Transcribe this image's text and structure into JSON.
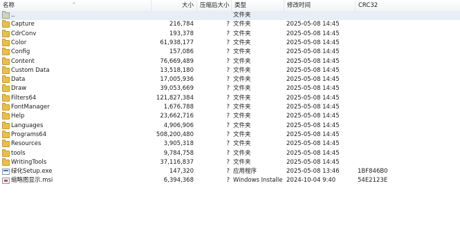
{
  "header": {
    "name": "名称",
    "size": "大小",
    "packed": "压缩后大小",
    "type": "类型",
    "modified": "修改时间",
    "crc": "CRC32"
  },
  "rows": [
    {
      "name": "..",
      "icon": "up-folder-icon",
      "size": "",
      "packed": "",
      "type": "文件夹",
      "modified": "",
      "crc": ""
    },
    {
      "name": "Capture",
      "icon": "folder-icon",
      "size": "216,784",
      "packed": "?",
      "type": "文件夹",
      "modified": "2025-05-08 14:45",
      "crc": ""
    },
    {
      "name": "CdrConv",
      "icon": "folder-icon",
      "size": "193,378",
      "packed": "?",
      "type": "文件夹",
      "modified": "2025-05-08 14:45",
      "crc": ""
    },
    {
      "name": "Color",
      "icon": "folder-icon",
      "size": "61,938,177",
      "packed": "?",
      "type": "文件夹",
      "modified": "2025-05-08 14:45",
      "crc": ""
    },
    {
      "name": "Config",
      "icon": "folder-icon",
      "size": "157,086",
      "packed": "?",
      "type": "文件夹",
      "modified": "2025-05-08 14:45",
      "crc": ""
    },
    {
      "name": "Content",
      "icon": "folder-icon",
      "size": "76,669,489",
      "packed": "?",
      "type": "文件夹",
      "modified": "2025-05-08 14:45",
      "crc": ""
    },
    {
      "name": "Custom Data",
      "icon": "folder-icon",
      "size": "13,518,180",
      "packed": "?",
      "type": "文件夹",
      "modified": "2025-05-08 14:45",
      "crc": ""
    },
    {
      "name": "Data",
      "icon": "folder-icon",
      "size": "17,005,936",
      "packed": "?",
      "type": "文件夹",
      "modified": "2025-05-08 14:45",
      "crc": ""
    },
    {
      "name": "Draw",
      "icon": "folder-icon",
      "size": "39,053,669",
      "packed": "?",
      "type": "文件夹",
      "modified": "2025-05-08 14:45",
      "crc": ""
    },
    {
      "name": "Filters64",
      "icon": "folder-icon",
      "size": "121,827,384",
      "packed": "?",
      "type": "文件夹",
      "modified": "2025-05-08 14:45",
      "crc": ""
    },
    {
      "name": "FontManager",
      "icon": "folder-icon",
      "size": "1,676,788",
      "packed": "?",
      "type": "文件夹",
      "modified": "2025-05-08 14:45",
      "crc": ""
    },
    {
      "name": "Help",
      "icon": "folder-icon",
      "size": "23,662,716",
      "packed": "?",
      "type": "文件夹",
      "modified": "2025-05-08 14:45",
      "crc": ""
    },
    {
      "name": "Languages",
      "icon": "folder-icon",
      "size": "4,906,906",
      "packed": "?",
      "type": "文件夹",
      "modified": "2025-05-08 14:45",
      "crc": ""
    },
    {
      "name": "Programs64",
      "icon": "folder-icon",
      "size": "508,200,480",
      "packed": "?",
      "type": "文件夹",
      "modified": "2025-05-08 14:45",
      "crc": ""
    },
    {
      "name": "Resources",
      "icon": "folder-icon",
      "size": "3,905,318",
      "packed": "?",
      "type": "文件夹",
      "modified": "2025-05-08 14:45",
      "crc": ""
    },
    {
      "name": "tools",
      "icon": "folder-icon",
      "size": "9,784,758",
      "packed": "?",
      "type": "文件夹",
      "modified": "2025-05-08 14:45",
      "crc": ""
    },
    {
      "name": "WritingTools",
      "icon": "folder-icon",
      "size": "37,116,837",
      "packed": "?",
      "type": "文件夹",
      "modified": "2025-05-08 14:45",
      "crc": ""
    },
    {
      "name": "绿化Setup.exe",
      "icon": "exe-icon",
      "size": "147,320",
      "packed": "?",
      "type": "应用程序",
      "modified": "2025-05-08 13:46",
      "crc": "1BF846B0"
    },
    {
      "name": "缩略图显示.msi",
      "icon": "msi-icon",
      "size": "6,394,368",
      "packed": "?",
      "type": "Windows Installe...",
      "modified": "2024-10-04 9:40",
      "crc": "54E2123E"
    }
  ]
}
